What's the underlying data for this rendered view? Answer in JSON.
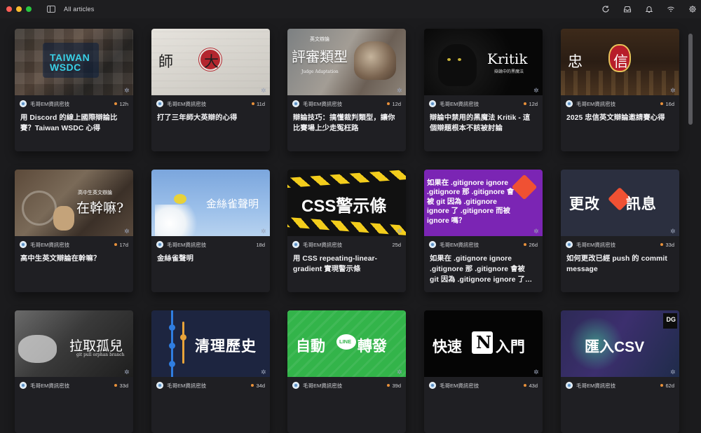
{
  "window": {
    "title": "All articles"
  },
  "toolbar": {
    "icons": [
      "refresh-icon",
      "inbox-icon",
      "bell-icon",
      "wifi-icon",
      "settings-icon"
    ]
  },
  "colors": {
    "unread_dot": "#e8913a",
    "background": "#1b1b1d",
    "card": "#1f1f23"
  },
  "cards": [
    {
      "thumb_text": "TAIWAN WSDC",
      "author": "毛哥EM資訊密技",
      "age": "12h",
      "title": "用 Discord 的線上國際辯論比賽？Taiwan WSDC 心得"
    },
    {
      "thumb_text": "師大 英辯",
      "author": "毛哥EM資訊密技",
      "age": "11d",
      "title": "打了三年師大英辯的心得"
    },
    {
      "thumb_text": "評審類型",
      "thumb_sub": "英文辯論",
      "thumb_sub2": "Judge Adaptation",
      "author": "毛哥EM資訊密技",
      "age": "12d",
      "title": "辯論技巧：搞懂裁判類型，讓你比賽場上少走冤枉路"
    },
    {
      "thumb_text": "Kritik",
      "thumb_sub": "辯論中的黑魔法",
      "author": "毛哥EM資訊密技",
      "age": "12d",
      "title": "辯論中禁用的黑魔法 Kritik - 這個辯題根本不該被討論"
    },
    {
      "thumb_text": "忠信 英辯",
      "author": "毛哥EM資訊密技",
      "age": "16d",
      "title": "2025 忠信英文辯論邀請賽心得"
    },
    {
      "thumb_text": "在幹嘛?",
      "thumb_sub": "高中生英文辯論",
      "author": "毛哥EM資訊密技",
      "age": "17d",
      "title": "高中生英文辯論在幹嘛？"
    },
    {
      "thumb_text": "金絲雀聲明",
      "author": "毛哥EM資訊密技",
      "age": "18d",
      "title": "金絲雀聲明"
    },
    {
      "thumb_text": "CSS警示條",
      "author": "毛哥EM資訊密技",
      "age": "25d",
      "title": "用 CSS repeating-linear-gradient 實現警示條"
    },
    {
      "thumb_text": "如果在 .gitignore ignore .gitignore 那 .gitignore 會被 git 因為 .gitignore ignore 了 .gitignore 而被 ignore 嗎？",
      "author": "毛哥EM資訊密技",
      "age": "26d",
      "title": "如果在 .gitignore ignore .gitignore 那 .gitignore 會被 git 因為 .gitignore ignore 了…"
    },
    {
      "thumb_text": "更改 訊息",
      "author": "毛哥EM資訊密技",
      "age": "33d",
      "title": "如何更改已經 push 的 commit message"
    },
    {
      "thumb_text": "拉取孤兒",
      "thumb_sub": "git pull orphan branch",
      "author": "毛哥EM資訊密技",
      "age": "33d",
      "title": ""
    },
    {
      "thumb_text": "清理歷史",
      "author": "毛哥EM資訊密技",
      "age": "34d",
      "title": ""
    },
    {
      "thumb_text": "自動 轉發",
      "thumb_sub": "LINE",
      "author": "毛哥EM資訊密技",
      "age": "39d",
      "title": ""
    },
    {
      "thumb_text": "快速 入門",
      "thumb_sub": "N",
      "author": "毛哥EM資訊密技",
      "age": "43d",
      "title": ""
    },
    {
      "thumb_text": "匯入CSV",
      "thumb_sub": "DG",
      "author": "毛哥EM資訊密技",
      "age": "62d",
      "title": ""
    }
  ]
}
